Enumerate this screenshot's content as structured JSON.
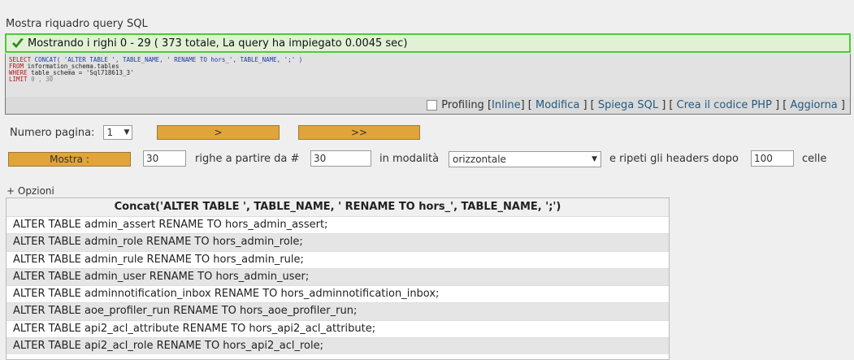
{
  "sql_toggle_label": "Mostra riquadro query SQL",
  "success_message": "Mostrando i righi 0 - 29 ( 373 totale, La query ha impiegato 0.0045 sec)",
  "sql": {
    "line1": {
      "kw": "SELECT",
      "fn": "CONCAT(",
      "str1": " 'ALTER TABLE ', TABLE_NAME, ' RENAME TO hors_', TABLE_NAME, ';' )"
    },
    "line2": {
      "kw": "FROM",
      "rest": " information_schema.tables"
    },
    "line3": {
      "kw": "WHERE",
      "rest": " table_schema = 'Sql718613_3'"
    },
    "line4": {
      "kw": "LIMIT",
      "rest": " 0 , 30"
    }
  },
  "tools": {
    "profiling": "Profiling",
    "inline": "Inline",
    "modifica": "Modifica",
    "spiega": "Spiega SQL",
    "crea": "Crea il codice PHP",
    "aggiorna": "Aggiorna"
  },
  "nav": {
    "page_label": "Numero pagina:",
    "page_value": "1",
    "next_label": ">",
    "last_label": ">>"
  },
  "display": {
    "show_button": "Mostra :",
    "rows_value": "30",
    "rows_label": "righe a partire da #",
    "start_value": "30",
    "mode_label": "in modalità",
    "mode_value": "orizzontale",
    "repeat_label": "e ripeti gli headers dopo",
    "repeat_value": "100",
    "cells_label": "celle"
  },
  "options_label": "+ Opzioni",
  "results": {
    "column_header": "Concat('ALTER TABLE ', TABLE_NAME, ' RENAME TO hors_', TABLE_NAME, ';')",
    "rows": [
      "ALTER TABLE admin_assert RENAME TO hors_admin_assert;",
      "ALTER TABLE admin_role RENAME TO hors_admin_role;",
      "ALTER TABLE admin_rule RENAME TO hors_admin_rule;",
      "ALTER TABLE admin_user RENAME TO hors_admin_user;",
      "ALTER TABLE adminnotification_inbox RENAME TO hors_adminnotification_inbox;",
      "ALTER TABLE aoe_profiler_run RENAME TO hors_aoe_profiler_run;",
      "ALTER TABLE api2_acl_attribute RENAME TO hors_api2_acl_attribute;",
      "ALTER TABLE api2_acl_role RENAME TO hors_api2_acl_role;"
    ]
  }
}
